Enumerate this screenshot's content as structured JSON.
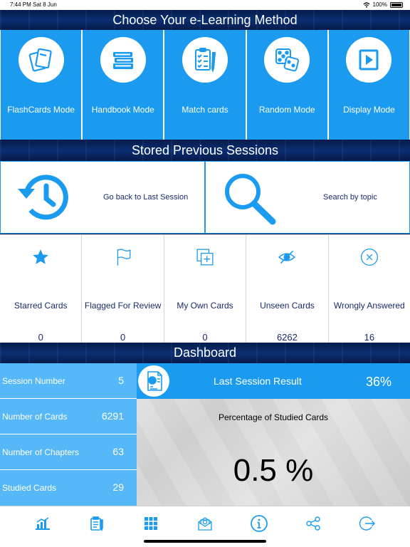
{
  "status_bar": {
    "time": "7:44 PM",
    "date": "Sat 8 Jun",
    "battery": "100%"
  },
  "methods_header": "Choose Your e-Learning Method",
  "methods": [
    {
      "label": "FlashCards Mode",
      "icon": "flashcards-icon"
    },
    {
      "label": "Handbook Mode",
      "icon": "books-icon"
    },
    {
      "label": "Match cards",
      "icon": "checklist-icon"
    },
    {
      "label": "Random Mode",
      "icon": "dice-icon"
    },
    {
      "label": "Display Mode",
      "icon": "play-icon"
    }
  ],
  "sessions_header": "Stored Previous Sessions",
  "sessions": [
    {
      "label": "Go back to Last Session",
      "icon": "history-icon"
    },
    {
      "label": "Search by topic",
      "icon": "search-icon"
    }
  ],
  "categories": [
    {
      "label": "Starred Cards",
      "count": "0",
      "icon": "star-icon"
    },
    {
      "label": "Flagged For Review",
      "count": "0",
      "icon": "flag-icon"
    },
    {
      "label": "My Own Cards",
      "count": "0",
      "icon": "add-card-icon"
    },
    {
      "label": "Unseen Cards",
      "count": "6262",
      "icon": "eye-slash-icon"
    },
    {
      "label": "Wrongly Answered",
      "count": "16",
      "icon": "x-circle-icon"
    }
  ],
  "dashboard_header": "Dashboard",
  "stats": [
    {
      "label": "Session Number",
      "value": "5"
    },
    {
      "label": "Number of Cards",
      "value": "6291"
    },
    {
      "label": "Number of Chapters",
      "value": "63"
    },
    {
      "label": "Studied Cards",
      "value": "29"
    }
  ],
  "last_session": {
    "label": "Last Session Result",
    "value": "36%",
    "icon": "report-icon"
  },
  "studied": {
    "title": "Percentage of Studied Cards",
    "value": "0.5 %"
  },
  "tabs": [
    "chart-icon",
    "notes-icon",
    "grid-icon",
    "mail-icon",
    "info-icon",
    "share-icon",
    "logout-icon"
  ],
  "colors": {
    "accent": "#1b9bf0",
    "dashboard_tile": "#56b8f7",
    "dark_text": "#1a2a6c"
  }
}
